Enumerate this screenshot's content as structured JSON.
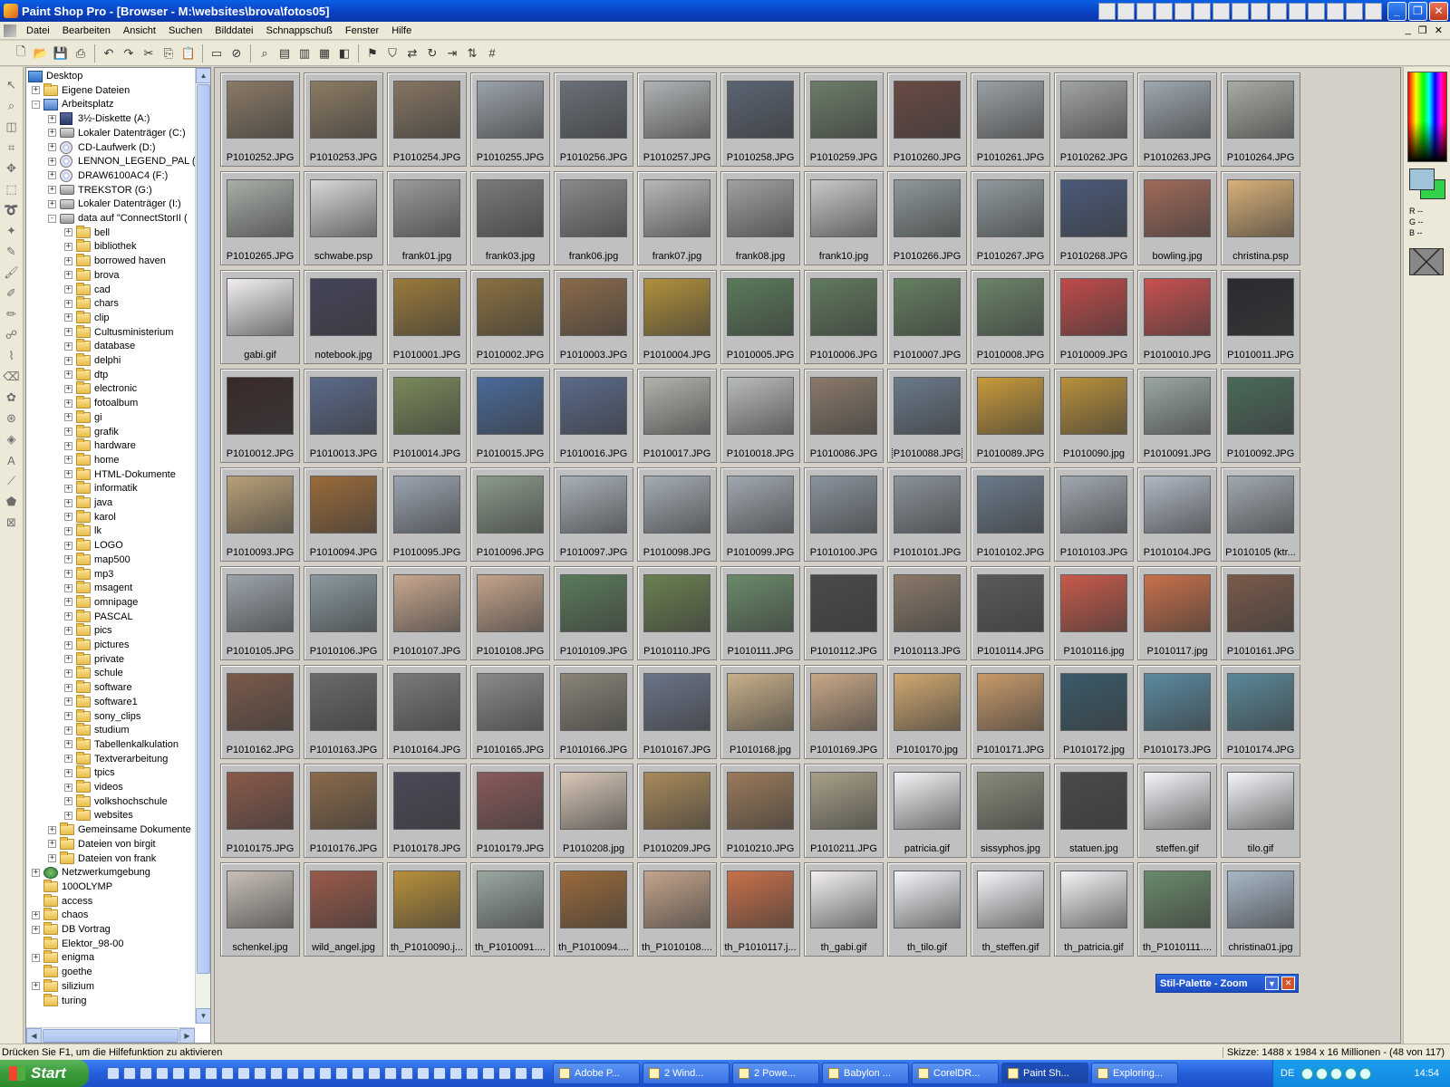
{
  "window": {
    "title": "Paint Shop Pro - [Browser - M:\\websites\\brova\\fotos05]"
  },
  "menu": [
    "Datei",
    "Bearbeiten",
    "Ansicht",
    "Suchen",
    "Bilddatei",
    "Schnappschuß",
    "Fenster",
    "Hilfe"
  ],
  "tree": [
    {
      "label": "Desktop",
      "indent": 0,
      "icon": "desktop-icon",
      "exp": ""
    },
    {
      "label": "Eigene Dateien",
      "indent": 1,
      "icon": "folder-icon",
      "exp": "+"
    },
    {
      "label": "Arbeitsplatz",
      "indent": 1,
      "icon": "computer-icon",
      "exp": "-"
    },
    {
      "label": "3½-Diskette (A:)",
      "indent": 2,
      "icon": "floppy-icon",
      "exp": "+"
    },
    {
      "label": "Lokaler Datenträger (C:)",
      "indent": 2,
      "icon": "drive-icon",
      "exp": "+"
    },
    {
      "label": "CD-Laufwerk (D:)",
      "indent": 2,
      "icon": "cd-icon",
      "exp": "+"
    },
    {
      "label": "LENNON_LEGEND_PAL (E:",
      "indent": 2,
      "icon": "cd-icon",
      "exp": "+"
    },
    {
      "label": "DRAW6100AC4 (F:)",
      "indent": 2,
      "icon": "cd-icon",
      "exp": "+"
    },
    {
      "label": "TREKSTOR (G:)",
      "indent": 2,
      "icon": "drive-icon",
      "exp": "+"
    },
    {
      "label": "Lokaler Datenträger (I:)",
      "indent": 2,
      "icon": "drive-icon",
      "exp": "+"
    },
    {
      "label": "data auf \"ConnectStorII (",
      "indent": 2,
      "icon": "drive-icon",
      "exp": "-"
    },
    {
      "label": "bell",
      "indent": 3,
      "icon": "folder-icon",
      "exp": "+"
    },
    {
      "label": "bibliothek",
      "indent": 3,
      "icon": "folder-icon",
      "exp": "+"
    },
    {
      "label": "borrowed haven",
      "indent": 3,
      "icon": "folder-icon",
      "exp": "+"
    },
    {
      "label": "brova",
      "indent": 3,
      "icon": "folder-icon",
      "exp": "+"
    },
    {
      "label": "cad",
      "indent": 3,
      "icon": "folder-icon",
      "exp": "+"
    },
    {
      "label": "chars",
      "indent": 3,
      "icon": "folder-icon",
      "exp": "+"
    },
    {
      "label": "clip",
      "indent": 3,
      "icon": "folder-icon",
      "exp": "+"
    },
    {
      "label": "Cultusministerium",
      "indent": 3,
      "icon": "folder-icon",
      "exp": "+"
    },
    {
      "label": "database",
      "indent": 3,
      "icon": "folder-icon",
      "exp": "+"
    },
    {
      "label": "delphi",
      "indent": 3,
      "icon": "folder-icon",
      "exp": "+"
    },
    {
      "label": "dtp",
      "indent": 3,
      "icon": "folder-icon",
      "exp": "+"
    },
    {
      "label": "electronic",
      "indent": 3,
      "icon": "folder-icon",
      "exp": "+"
    },
    {
      "label": "fotoalbum",
      "indent": 3,
      "icon": "folder-icon",
      "exp": "+"
    },
    {
      "label": "gi",
      "indent": 3,
      "icon": "folder-icon",
      "exp": "+"
    },
    {
      "label": "grafik",
      "indent": 3,
      "icon": "folder-icon",
      "exp": "+"
    },
    {
      "label": "hardware",
      "indent": 3,
      "icon": "folder-icon",
      "exp": "+"
    },
    {
      "label": "home",
      "indent": 3,
      "icon": "folder-icon",
      "exp": "+"
    },
    {
      "label": "HTML-Dokumente",
      "indent": 3,
      "icon": "folder-icon",
      "exp": "+"
    },
    {
      "label": "informatik",
      "indent": 3,
      "icon": "folder-icon",
      "exp": "+"
    },
    {
      "label": "java",
      "indent": 3,
      "icon": "folder-icon",
      "exp": "+"
    },
    {
      "label": "karol",
      "indent": 3,
      "icon": "folder-icon",
      "exp": "+"
    },
    {
      "label": "lk",
      "indent": 3,
      "icon": "folder-icon",
      "exp": "+"
    },
    {
      "label": "LOGO",
      "indent": 3,
      "icon": "folder-icon",
      "exp": "+"
    },
    {
      "label": "map500",
      "indent": 3,
      "icon": "folder-icon",
      "exp": "+"
    },
    {
      "label": "mp3",
      "indent": 3,
      "icon": "folder-icon",
      "exp": "+"
    },
    {
      "label": "msagent",
      "indent": 3,
      "icon": "folder-icon",
      "exp": "+"
    },
    {
      "label": "omnipage",
      "indent": 3,
      "icon": "folder-icon",
      "exp": "+"
    },
    {
      "label": "PASCAL",
      "indent": 3,
      "icon": "folder-icon",
      "exp": "+"
    },
    {
      "label": "pics",
      "indent": 3,
      "icon": "folder-icon",
      "exp": "+"
    },
    {
      "label": "pictures",
      "indent": 3,
      "icon": "folder-icon",
      "exp": "+"
    },
    {
      "label": "private",
      "indent": 3,
      "icon": "folder-icon",
      "exp": "+"
    },
    {
      "label": "schule",
      "indent": 3,
      "icon": "folder-icon",
      "exp": "+"
    },
    {
      "label": "software",
      "indent": 3,
      "icon": "folder-icon",
      "exp": "+"
    },
    {
      "label": "software1",
      "indent": 3,
      "icon": "folder-icon",
      "exp": "+"
    },
    {
      "label": "sony_clips",
      "indent": 3,
      "icon": "folder-icon",
      "exp": "+"
    },
    {
      "label": "studium",
      "indent": 3,
      "icon": "folder-icon",
      "exp": "+"
    },
    {
      "label": "Tabellenkalkulation",
      "indent": 3,
      "icon": "folder-icon",
      "exp": "+"
    },
    {
      "label": "Textverarbeitung",
      "indent": 3,
      "icon": "folder-icon",
      "exp": "+"
    },
    {
      "label": "tpics",
      "indent": 3,
      "icon": "folder-icon",
      "exp": "+"
    },
    {
      "label": "videos",
      "indent": 3,
      "icon": "folder-icon",
      "exp": "+"
    },
    {
      "label": "volkshochschule",
      "indent": 3,
      "icon": "folder-icon",
      "exp": "+"
    },
    {
      "label": "websites",
      "indent": 3,
      "icon": "folder-icon",
      "exp": "+"
    },
    {
      "label": "Gemeinsame Dokumente",
      "indent": 2,
      "icon": "folder-icon",
      "exp": "+"
    },
    {
      "label": "Dateien von birgit",
      "indent": 2,
      "icon": "folder-icon",
      "exp": "+"
    },
    {
      "label": "Dateien von frank",
      "indent": 2,
      "icon": "folder-icon",
      "exp": "+"
    },
    {
      "label": "Netzwerkumgebung",
      "indent": 1,
      "icon": "network-icon",
      "exp": "+"
    },
    {
      "label": "100OLYMP",
      "indent": 1,
      "icon": "folder-icon",
      "exp": ""
    },
    {
      "label": "access",
      "indent": 1,
      "icon": "folder-icon",
      "exp": ""
    },
    {
      "label": "chaos",
      "indent": 1,
      "icon": "folder-icon",
      "exp": "+"
    },
    {
      "label": "DB Vortrag",
      "indent": 1,
      "icon": "folder-icon",
      "exp": "+"
    },
    {
      "label": "Elektor_98-00",
      "indent": 1,
      "icon": "folder-icon",
      "exp": ""
    },
    {
      "label": "enigma",
      "indent": 1,
      "icon": "folder-icon",
      "exp": "+"
    },
    {
      "label": "goethe",
      "indent": 1,
      "icon": "folder-icon",
      "exp": ""
    },
    {
      "label": "silizium",
      "indent": 1,
      "icon": "folder-icon",
      "exp": "+"
    },
    {
      "label": "turing",
      "indent": 1,
      "icon": "folder-icon",
      "exp": ""
    }
  ],
  "thumbnails": [
    {
      "name": "P1010252.JPG",
      "c": "#8a7a66"
    },
    {
      "name": "P1010253.JPG",
      "c": "#8c7b63"
    },
    {
      "name": "P1010254.JPG",
      "c": "#857562"
    },
    {
      "name": "P1010255.JPG",
      "c": "#9aa2aa"
    },
    {
      "name": "P1010256.JPG",
      "c": "#6a7078"
    },
    {
      "name": "P1010257.JPG",
      "c": "#b0b4b6"
    },
    {
      "name": "P1010258.JPG",
      "c": "#5a6472"
    },
    {
      "name": "P1010259.JPG",
      "c": "#6c7d68"
    },
    {
      "name": "P1010260.JPG",
      "c": "#6a4a44"
    },
    {
      "name": "P1010261.JPG",
      "c": "#9aa0a4"
    },
    {
      "name": "P1010262.JPG",
      "c": "#a0a4a2"
    },
    {
      "name": "P1010263.JPG",
      "c": "#9ea8b0"
    },
    {
      "name": "P1010264.JPG",
      "c": "#a8aca4"
    },
    {
      "name": "P1010265.JPG",
      "c": "#a8aea8"
    },
    {
      "name": "schwabe.psp",
      "c": "#d8d8d8"
    },
    {
      "name": "frank01.jpg",
      "c": "#9a9a9a"
    },
    {
      "name": "frank03.jpg",
      "c": "#7a7a7a"
    },
    {
      "name": "frank06.jpg",
      "c": "#8a8a8a"
    },
    {
      "name": "frank07.jpg",
      "c": "#b8b8b8"
    },
    {
      "name": "frank08.jpg",
      "c": "#a0a0a0"
    },
    {
      "name": "frank10.jpg",
      "c": "#c8c8c8"
    },
    {
      "name": "P1010266.JPG",
      "c": "#8e989a"
    },
    {
      "name": "P1010267.JPG",
      "c": "#909a9e"
    },
    {
      "name": "P1010268.JPG",
      "c": "#4a5a7a"
    },
    {
      "name": "bowling.jpg",
      "c": "#a06a5a"
    },
    {
      "name": "christina.psp",
      "c": "#d8b078"
    },
    {
      "name": "gabi.gif",
      "c": "#f4f0f2"
    },
    {
      "name": "notebook.jpg",
      "c": "#44445a"
    },
    {
      "name": "P1010001.JPG",
      "c": "#9a7a3a"
    },
    {
      "name": "P1010002.JPG",
      "c": "#8a7040"
    },
    {
      "name": "P1010003.JPG",
      "c": "#8a6a4a"
    },
    {
      "name": "P1010004.JPG",
      "c": "#b0903a"
    },
    {
      "name": "P1010005.JPG",
      "c": "#5a7a5a"
    },
    {
      "name": "P1010006.JPG",
      "c": "#607a5c"
    },
    {
      "name": "P1010007.JPG",
      "c": "#648060"
    },
    {
      "name": "P1010008.JPG",
      "c": "#6a8468"
    },
    {
      "name": "P1010009.JPG",
      "c": "#c04a4a"
    },
    {
      "name": "P1010010.JPG",
      "c": "#c85050"
    },
    {
      "name": "P1010011.JPG",
      "c": "#2a2a30"
    },
    {
      "name": "P1010012.JPG",
      "c": "#3a2a2a"
    },
    {
      "name": "P1010013.JPG",
      "c": "#5a6a8a"
    },
    {
      "name": "P1010014.JPG",
      "c": "#7a8a5a"
    },
    {
      "name": "P1010015.JPG",
      "c": "#4a6a9a"
    },
    {
      "name": "P1010016.JPG",
      "c": "#5a6a8a"
    },
    {
      "name": "P1010017.JPG",
      "c": "#b0b4ac"
    },
    {
      "name": "P1010018.JPG",
      "c": "#b8bcb8"
    },
    {
      "name": "P1010086.JPG",
      "c": "#8a7a6a"
    },
    {
      "name": "P1010088.JPG",
      "c": "#6a7a8a",
      "selected": true
    },
    {
      "name": "P1010089.JPG",
      "c": "#c89a3a"
    },
    {
      "name": "P1010090.jpg",
      "c": "#b8903a"
    },
    {
      "name": "P1010091.JPG",
      "c": "#9aa8a0"
    },
    {
      "name": "P1010092.JPG",
      "c": "#4a6a5a"
    },
    {
      "name": "P1010093.JPG",
      "c": "#b8a078"
    },
    {
      "name": "P1010094.JPG",
      "c": "#9a6a3a"
    },
    {
      "name": "P1010095.JPG",
      "c": "#9aa4b0"
    },
    {
      "name": "P1010096.JPG",
      "c": "#8a9a8a"
    },
    {
      "name": "P1010097.JPG",
      "c": "#a8b0b8"
    },
    {
      "name": "P1010098.JPG",
      "c": "#a4acb4"
    },
    {
      "name": "P1010099.JPG",
      "c": "#a0a8b0"
    },
    {
      "name": "P1010100.JPG",
      "c": "#8a949e"
    },
    {
      "name": "P1010101.JPG",
      "c": "#8a929a"
    },
    {
      "name": "P1010102.JPG",
      "c": "#6a7a8a"
    },
    {
      "name": "P1010103.JPG",
      "c": "#a0a8b0"
    },
    {
      "name": "P1010104.JPG",
      "c": "#b0b8c4"
    },
    {
      "name": "P1010105 (ktr...",
      "c": "#a0a8b0"
    },
    {
      "name": "P1010105.JPG",
      "c": "#9ca4ac"
    },
    {
      "name": "P1010106.JPG",
      "c": "#8a9aa0"
    },
    {
      "name": "P1010107.JPG",
      "c": "#c8a890"
    },
    {
      "name": "P1010108.JPG",
      "c": "#c4a48c"
    },
    {
      "name": "P1010109.JPG",
      "c": "#5a7a5a"
    },
    {
      "name": "P1010110.JPG",
      "c": "#6a8050"
    },
    {
      "name": "P1010111.JPG",
      "c": "#6a8a6a"
    },
    {
      "name": "P1010112.JPG",
      "c": "#4a4a4a"
    },
    {
      "name": "P1010113.JPG",
      "c": "#8a7a6a"
    },
    {
      "name": "P1010114.JPG",
      "c": "#5a5a5a"
    },
    {
      "name": "P1010116.jpg",
      "c": "#c85a4a"
    },
    {
      "name": "P1010117.jpg",
      "c": "#c8704a"
    },
    {
      "name": "P1010161.JPG",
      "c": "#7a5a4a"
    },
    {
      "name": "P1010162.JPG",
      "c": "#7a5a4a"
    },
    {
      "name": "P1010163.JPG",
      "c": "#6a6a6a"
    },
    {
      "name": "P1010164.JPG",
      "c": "#7a7a7a"
    },
    {
      "name": "P1010165.JPG",
      "c": "#8a8a8a"
    },
    {
      "name": "P1010166.JPG",
      "c": "#8a8478"
    },
    {
      "name": "P1010167.JPG",
      "c": "#6a7488"
    },
    {
      "name": "P1010168.jpg",
      "c": "#c8b08a"
    },
    {
      "name": "P1010169.JPG",
      "c": "#c8a888"
    },
    {
      "name": "P1010170.jpg",
      "c": "#d0a870"
    },
    {
      "name": "P1010171.JPG",
      "c": "#c89a6a"
    },
    {
      "name": "P1010172.jpg",
      "c": "#3a5a6a"
    },
    {
      "name": "P1010173.JPG",
      "c": "#5a8aa0"
    },
    {
      "name": "P1010174.JPG",
      "c": "#5a8898"
    },
    {
      "name": "P1010175.JPG",
      "c": "#8a5a4a"
    },
    {
      "name": "P1010176.JPG",
      "c": "#8a6a4a"
    },
    {
      "name": "P1010178.JPG",
      "c": "#4a4a5a"
    },
    {
      "name": "P1010179.JPG",
      "c": "#8a5a5a"
    },
    {
      "name": "P1010208.jpg",
      "c": "#d8c8b8"
    },
    {
      "name": "P1010209.JPG",
      "c": "#a88a5a"
    },
    {
      "name": "P1010210.JPG",
      "c": "#9a7a5a"
    },
    {
      "name": "P1010211.JPG",
      "c": "#a8a088"
    },
    {
      "name": "patricia.gif",
      "c": "#f4f4f8"
    },
    {
      "name": "sissyphos.jpg",
      "c": "#8a8a7a"
    },
    {
      "name": "statuen.jpg",
      "c": "#4a4a4a"
    },
    {
      "name": "steffen.gif",
      "c": "#f4f6fa"
    },
    {
      "name": "tilo.gif",
      "c": "#f4f6fa"
    },
    {
      "name": "schenkel.jpg",
      "c": "#c8c0b8"
    },
    {
      "name": "wild_angel.jpg",
      "c": "#9a5a4a"
    },
    {
      "name": "th_P1010090.j...",
      "c": "#b8903a"
    },
    {
      "name": "th_P1010091....",
      "c": "#9aa8a0"
    },
    {
      "name": "th_P1010094....",
      "c": "#9a6a3a"
    },
    {
      "name": "th_P1010108....",
      "c": "#c4a48c"
    },
    {
      "name": "th_P1010117.j...",
      "c": "#c8704a"
    },
    {
      "name": "th_gabi.gif",
      "c": "#f4f0f2"
    },
    {
      "name": "th_tilo.gif",
      "c": "#f4f6fa"
    },
    {
      "name": "th_steffen.gif",
      "c": "#f4f6fa"
    },
    {
      "name": "th_patricia.gif",
      "c": "#f4f4f8"
    },
    {
      "name": "th_P1010111....",
      "c": "#6a8a6a"
    },
    {
      "name": "christina01.jpg",
      "c": "#a8b8c8"
    }
  ],
  "palette": {
    "title": "Stil-Palette - Zoom",
    "rgb": [
      "R --",
      "G --",
      "B --"
    ]
  },
  "status": {
    "left": "Drücken Sie F1, um die Hilfefunktion zu aktivieren",
    "right": "Skizze: 1488 x 1984 x 16 Millionen - (48 von 117)"
  },
  "taskbar": {
    "start": "Start",
    "items": [
      {
        "label": "Adobe P...",
        "active": false
      },
      {
        "label": "2 Wind...",
        "active": false
      },
      {
        "label": "2 Powe...",
        "active": false
      },
      {
        "label": "Babylon ...",
        "active": false
      },
      {
        "label": "CorelDR...",
        "active": false
      },
      {
        "label": "Paint Sh...",
        "active": true
      },
      {
        "label": "Exploring...",
        "active": false
      }
    ],
    "lang": "DE",
    "clock": "14:54"
  }
}
